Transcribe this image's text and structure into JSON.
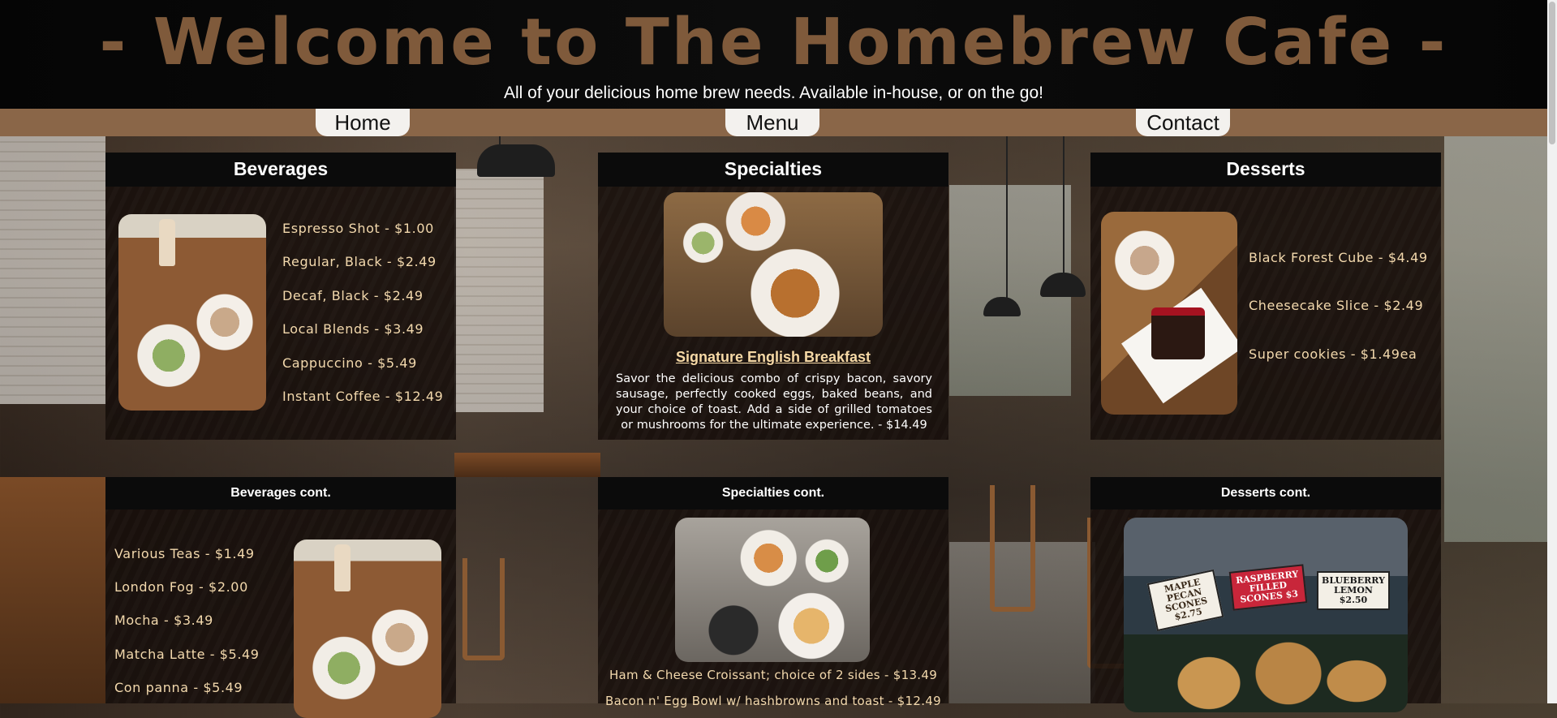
{
  "header": {
    "title": "- Welcome to The Homebrew Cafe -",
    "tagline": "All of your delicious home brew needs. Available in-house, or on the go!"
  },
  "nav": {
    "items": [
      {
        "label": "Home"
      },
      {
        "label": "Menu"
      },
      {
        "label": "Contact"
      }
    ]
  },
  "sections": {
    "beverages": {
      "title": "Beverages",
      "items": [
        "Espresso Shot - $1.00",
        "Regular, Black - $2.49",
        "Decaf, Black - $2.49",
        "Local Blends - $3.49",
        "Cappuccino - $5.49",
        "Instant Coffee - $12.49"
      ]
    },
    "specialties": {
      "title": "Specialties",
      "featured_title": "Signature English Breakfast",
      "featured_desc": "Savor the delicious combo of crispy bacon, savory sausage, perfectly cooked eggs, baked beans, and your choice of toast. Add a side of grilled tomatoes or mushrooms for the ultimate experience. - $14.49"
    },
    "desserts": {
      "title": "Desserts",
      "items": [
        "Black Forest Cube - $4.49",
        "Cheesecake Slice - $2.49",
        "Super cookies - $1.49ea"
      ]
    },
    "beverages_cont": {
      "title": "Beverages cont.",
      "items": [
        "Various Teas - $1.49",
        "London Fog - $2.00",
        "Mocha - $3.49",
        "Matcha Latte - $5.49",
        "Con panna - $5.49"
      ]
    },
    "specialties_cont": {
      "title": "Specialties cont.",
      "items": [
        "Ham & Cheese Croissant; choice of 2 sides - $13.49",
        "Bacon n' Egg Bowl w/ hashbrowns and toast - $12.49"
      ]
    },
    "desserts_cont": {
      "title": "Desserts cont.",
      "signs": [
        {
          "text": "MAPLE PECAN SCONES $2.75"
        },
        {
          "text": "RASPBERRY FILLED SCONES $3"
        },
        {
          "text": "BLUEBERRY LEMON $2.50"
        }
      ]
    }
  },
  "colors": {
    "accent_brown": "#8a6648",
    "title_brown": "#7f5a3b",
    "menu_text": "#f3d9ad",
    "header_bg": "#050505"
  }
}
